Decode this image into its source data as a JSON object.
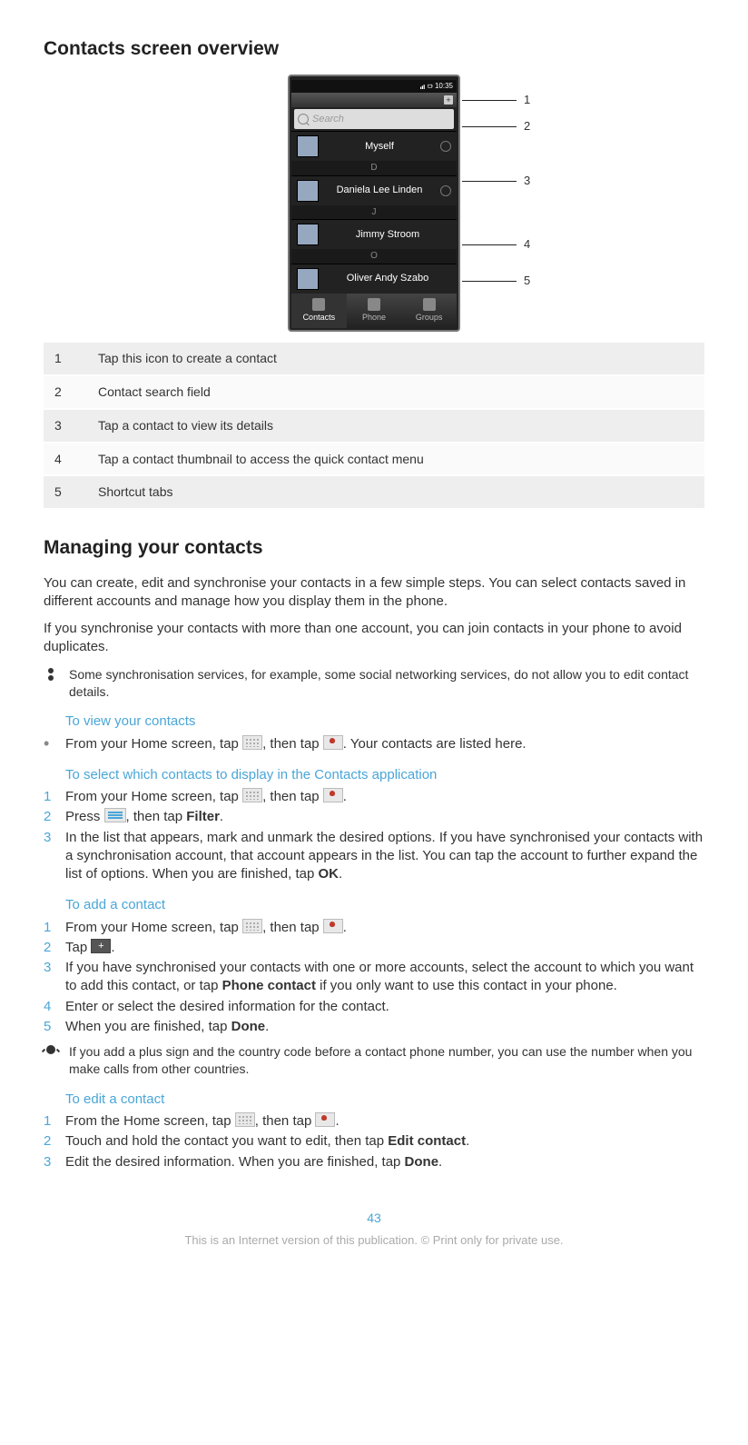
{
  "overview": {
    "title": "Contacts screen overview",
    "statusbar_time": "10:35",
    "search_placeholder": "Search",
    "contacts": [
      {
        "section": "",
        "name": "Myself"
      },
      {
        "section": "D",
        "name": "Daniela Lee Linden"
      },
      {
        "section": "J",
        "name": "Jimmy Stroom"
      },
      {
        "section": "O",
        "name": "Oliver Andy Szabo"
      }
    ],
    "tabs": [
      "Contacts",
      "Phone",
      "Groups"
    ],
    "callouts": [
      "1",
      "2",
      "3",
      "4",
      "5"
    ],
    "legend": [
      {
        "n": "1",
        "t": "Tap this icon to create a contact"
      },
      {
        "n": "2",
        "t": "Contact search field"
      },
      {
        "n": "3",
        "t": "Tap a contact to view its details"
      },
      {
        "n": "4",
        "t": "Tap a contact thumbnail to access the quick contact menu"
      },
      {
        "n": "5",
        "t": "Shortcut tabs"
      }
    ]
  },
  "managing": {
    "title": "Managing your contacts",
    "p1": "You can create, edit and synchronise your contacts in a few simple steps. You can select contacts saved in different accounts and manage how you display them in the phone.",
    "p2": "If you synchronise your contacts with more than one account, you can join contacts in your phone to avoid duplicates.",
    "note1": "Some synchronisation services, for example, some social networking services, do not allow you to edit contact details."
  },
  "view": {
    "title": "To view your contacts",
    "step": {
      "a": "From your Home screen, tap ",
      "b": ", then tap ",
      "c": ". Your contacts are listed here."
    }
  },
  "select": {
    "title": "To select which contacts to display in the Contacts application",
    "s1a": "From your Home screen, tap ",
    "s1b": ", then tap ",
    "s1c": ".",
    "s2a": "Press ",
    "s2b": ", then tap ",
    "s2c": "Filter",
    "s2d": ".",
    "s3a": "In the list that appears, mark and unmark the desired options. If you have synchronised your contacts with a synchronisation account, that account appears in the list. You can tap the account to further expand the list of options. When you are finished, tap ",
    "s3b": "OK",
    "s3c": "."
  },
  "add": {
    "title": "To add a contact",
    "s1a": "From your Home screen, tap ",
    "s1b": ", then tap ",
    "s1c": ".",
    "s2a": "Tap ",
    "s2b": ".",
    "s3a": "If you have synchronised your contacts with one or more accounts, select the account to which you want to add this contact, or tap ",
    "s3b": "Phone contact",
    "s3c": " if you only want to use this contact in your phone.",
    "s4": "Enter or select the desired information for the contact.",
    "s5a": "When you are finished, tap ",
    "s5b": "Done",
    "s5c": ".",
    "tip": "If you add a plus sign and the country code before a contact phone number, you can use the number when you make calls from other countries."
  },
  "edit": {
    "title": "To edit a contact",
    "s1a": "From the Home screen, tap ",
    "s1b": ", then tap ",
    "s1c": ".",
    "s2a": "Touch and hold the contact you want to edit, then tap ",
    "s2b": "Edit contact",
    "s2c": ".",
    "s3a": "Edit the desired information. When you are finished, tap ",
    "s3b": "Done",
    "s3c": "."
  },
  "page_number": "43",
  "footer": "This is an Internet version of this publication. © Print only for private use."
}
